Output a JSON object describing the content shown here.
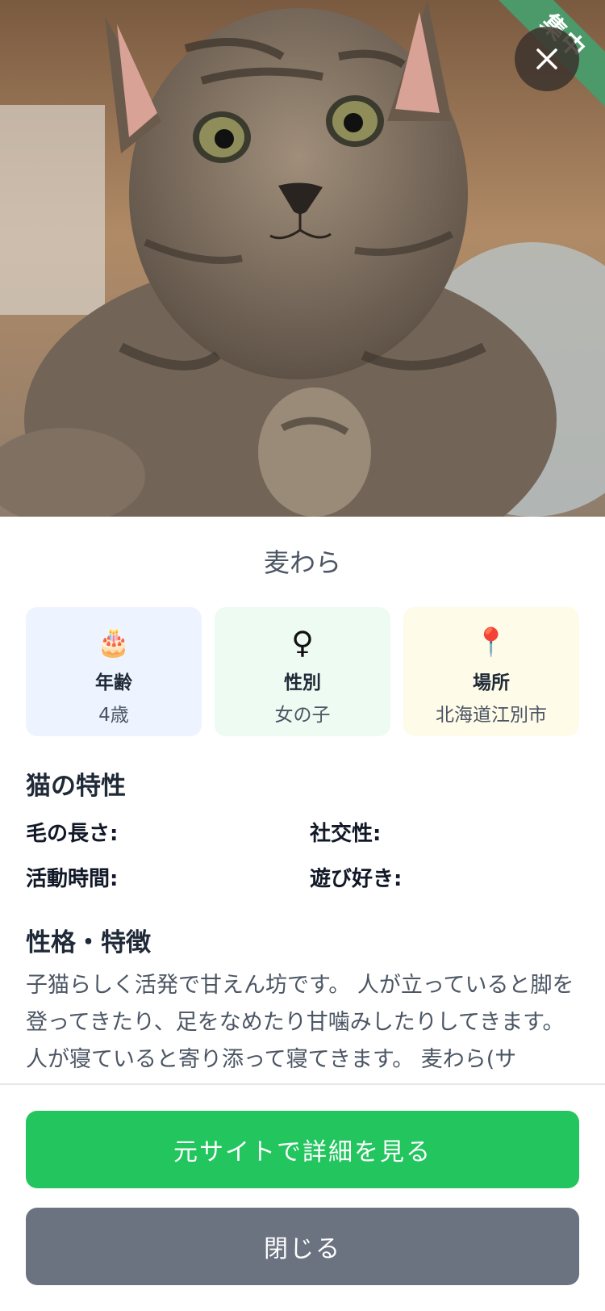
{
  "hero": {
    "ribbon_text": "集中",
    "photo_name": "tabby-kitten-photo"
  },
  "cat_name": "麦わら",
  "info_cards": [
    {
      "icon": "cake-icon",
      "glyph": "🎂",
      "label": "年齢",
      "value": "4歳"
    },
    {
      "icon": "female-icon",
      "glyph": "♀",
      "label": "性別",
      "value": "女の子"
    },
    {
      "icon": "pin-icon",
      "glyph": "📍",
      "label": "場所",
      "value": "北海道江別市"
    }
  ],
  "traits_section": {
    "title": "猫の特性",
    "fur_length": "毛の長さ:",
    "sociability": "社交性:",
    "active_time": "活動時間:",
    "playfulness": "遊び好き:"
  },
  "personality": {
    "title": "性格・特徴",
    "text": "子猫らしく活発で甘えん坊です。 人が立っていると脚を登ってきたり、足をなめたり甘噛みしたりしてきます。人が寝ていると寄り添って寝てきます。 麦わら(サ"
  },
  "buttons": {
    "view_details": "元サイトで詳細を見る",
    "close": "閉じる"
  },
  "colors": {
    "primary": "#22c55e",
    "secondary": "#6b7280",
    "ribbon": "#4c9a6a"
  }
}
